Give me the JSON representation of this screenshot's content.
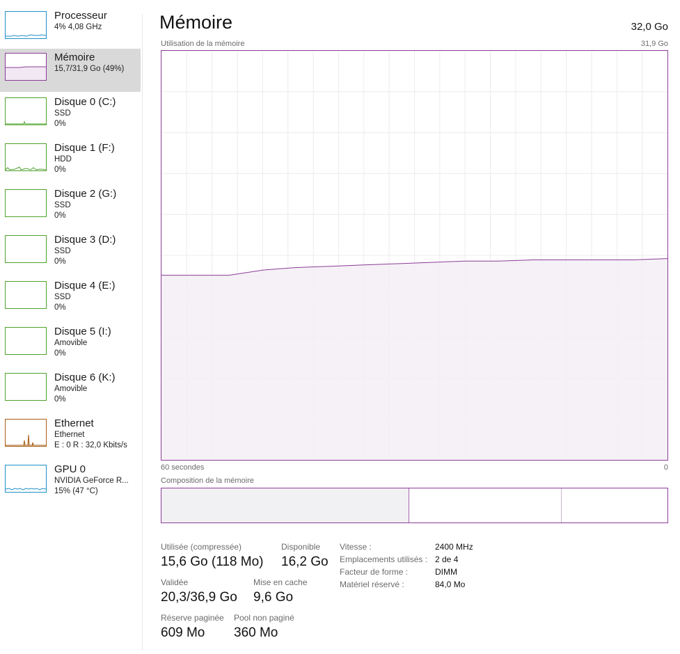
{
  "colors": {
    "cpu": "#1e8fc8",
    "memory": "#8b3c97",
    "disk": "#4da12b",
    "ethernet": "#a75c13",
    "gpu": "#1e8fc8",
    "selected_bg": "#d9d9d9"
  },
  "sidebar": {
    "items": [
      {
        "title": "Processeur",
        "line2": "4% 4,08 GHz",
        "line3": "",
        "icon": "cpu-graph",
        "color": "#1e8fc8"
      },
      {
        "title": "Mémoire",
        "line2": "15,7/31,9 Go (49%)",
        "line3": "",
        "icon": "memory-graph",
        "color": "#8b3c97"
      },
      {
        "title": "Disque 0 (C:)",
        "line2": "SSD",
        "line3": "0%",
        "icon": "disk-graph",
        "color": "#4da12b"
      },
      {
        "title": "Disque 1 (F:)",
        "line2": "HDD",
        "line3": "0%",
        "icon": "disk-graph",
        "color": "#4da12b"
      },
      {
        "title": "Disque 2 (G:)",
        "line2": "SSD",
        "line3": "0%",
        "icon": "disk-graph",
        "color": "#4da12b"
      },
      {
        "title": "Disque 3 (D:)",
        "line2": "SSD",
        "line3": "0%",
        "icon": "disk-graph",
        "color": "#4da12b"
      },
      {
        "title": "Disque 4 (E:)",
        "line2": "SSD",
        "line3": "0%",
        "icon": "disk-graph",
        "color": "#4da12b"
      },
      {
        "title": "Disque 5 (I:)",
        "line2": "Amovible",
        "line3": "0%",
        "icon": "disk-graph",
        "color": "#4da12b"
      },
      {
        "title": "Disque 6 (K:)",
        "line2": "Amovible",
        "line3": "0%",
        "icon": "disk-graph",
        "color": "#4da12b"
      },
      {
        "title": "Ethernet",
        "line2": "Ethernet",
        "line3": "E : 0 R : 32,0 Kbits/s",
        "icon": "ethernet-graph",
        "color": "#a75c13"
      },
      {
        "title": "GPU 0",
        "line2": "NVIDIA GeForce R...",
        "line3": "15% (47 °C)",
        "icon": "gpu-graph",
        "color": "#1e8fc8"
      }
    ],
    "selected_index": 1
  },
  "main": {
    "title": "Mémoire",
    "total": "32,0 Go",
    "graph_label": "Utilisation de la mémoire",
    "graph_max": "31,9 Go",
    "time_left": "60 secondes",
    "time_right": "0",
    "composition_label": "Composition de la mémoire",
    "composition": {
      "in_use_fraction": 0.49,
      "standby_end_fraction": 0.79
    }
  },
  "chart_data": {
    "type": "area",
    "title": "Utilisation de la mémoire",
    "xlabel": "",
    "ylabel": "",
    "x_range_label": [
      "60 secondes",
      "0"
    ],
    "x": [
      60,
      56,
      52,
      48,
      44,
      40,
      36,
      32,
      28,
      24,
      20,
      16,
      12,
      8,
      4,
      0
    ],
    "ylim": [
      0,
      31.9
    ],
    "series": [
      {
        "values": [
          14.4,
          14.4,
          14.4,
          14.8,
          15.0,
          15.1,
          15.2,
          15.3,
          15.4,
          15.5,
          15.5,
          15.6,
          15.6,
          15.6,
          15.6,
          15.7
        ]
      }
    ],
    "grid": true
  },
  "stats": {
    "used_label": "Utilisée (compressée)",
    "used_value": "15,6 Go (118 Mo)",
    "available_label": "Disponible",
    "available_value": "16,2 Go",
    "committed_label": "Validée",
    "committed_value": "20,3/36,9 Go",
    "cached_label": "Mise en cache",
    "cached_value": "9,6 Go",
    "paged_label": "Réserve paginée",
    "paged_value": "609 Mo",
    "nonpaged_label": "Pool non paginé",
    "nonpaged_value": "360 Mo"
  },
  "properties": [
    {
      "label": "Vitesse :",
      "value": "2400 MHz"
    },
    {
      "label": "Emplacements utilisés :",
      "value": "2 de 4"
    },
    {
      "label": "Facteur de forme :",
      "value": "DIMM"
    },
    {
      "label": "Matériel réservé :",
      "value": "84,0 Mo"
    }
  ]
}
